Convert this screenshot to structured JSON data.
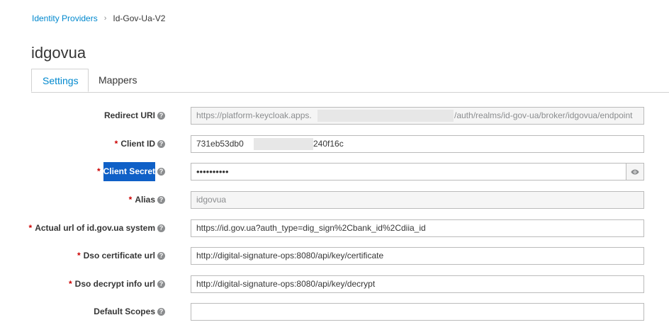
{
  "breadcrumb": {
    "parent": "Identity Providers",
    "separator": "›",
    "current": "Id-Gov-Ua-V2"
  },
  "page_title": "idgovua",
  "tabs": [
    {
      "label": "Settings",
      "active": true
    },
    {
      "label": "Mappers",
      "active": false
    }
  ],
  "help_glyph": "?",
  "required_mark": "*",
  "fields": {
    "redirect_uri": {
      "label": "Redirect URI",
      "value_prefix": "https://platform-keycloak.apps.",
      "value_suffix": "/auth/realms/id-gov-ua/broker/idgovua/endpoint"
    },
    "client_id": {
      "label": "Client ID",
      "value_prefix": "731eb53db0",
      "value_suffix": "240f16c"
    },
    "client_secret": {
      "label": "Client Secret",
      "value": "••••••••••"
    },
    "alias": {
      "label": "Alias",
      "value": "idgovua"
    },
    "actual_url": {
      "label": "Actual url of id.gov.ua system",
      "value": "https://id.gov.ua?auth_type=dig_sign%2Cbank_id%2Cdiia_id"
    },
    "dso_certificate_url": {
      "label": "Dso certificate url",
      "value": "http://digital-signature-ops:8080/api/key/certificate"
    },
    "dso_decrypt_info_url": {
      "label": "Dso decrypt info url",
      "value": "http://digital-signature-ops:8080/api/key/decrypt"
    },
    "default_scopes": {
      "label": "Default Scopes",
      "value": ""
    }
  },
  "colors": {
    "link": "#0088ce",
    "required": "#cc0000",
    "selection": "#0f60c7"
  },
  "icons": {
    "help": "question-circle-icon",
    "reveal": "eye-icon"
  }
}
